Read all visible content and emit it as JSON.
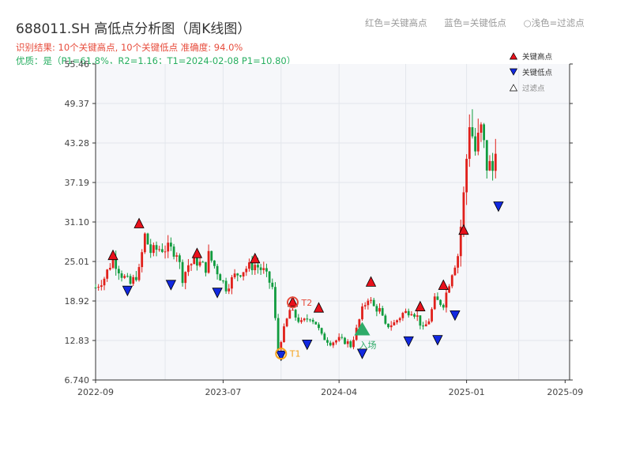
{
  "header": {
    "title": "688011.SH 高低点分析图（周K线图）",
    "result_text": "识别结果: 10个关键高点, 10个关键低点   准确度: 94.0%",
    "quality_text": "优质：是（P1=61.8%，R2=1.16；T1=2024-02-08 P1=10.80）",
    "legend_text": [
      "红色=关键高点",
      "蓝色=关键低点",
      "○浅色=过滤点"
    ]
  },
  "colors": {
    "up": "#e0201b",
    "down": "#119c3f",
    "high_marker": "#e8111b",
    "low_marker": "#1128e0",
    "t_marker": "#f5a21b",
    "t2_label": "#e74c3c",
    "entry": "#2eab68",
    "plot_bg": "#f6f7fa",
    "grid": "#e3e6ec"
  },
  "chart_data": {
    "type": "candlestick",
    "title": "688011.SH 高低点分析图（周K线图）",
    "y_ticks": [
      "55.46",
      "49.37",
      "43.28",
      "37.19",
      "31.10",
      "25.01",
      "18.92",
      "12.83",
      "6.740"
    ],
    "ylim": [
      6.74,
      55.46
    ],
    "x_ticks": [
      "2022-09",
      "2023-07",
      "2024-04",
      "2025-01",
      "2025-09"
    ],
    "x_tick_weeks": [
      0,
      44,
      84,
      128,
      162
    ],
    "x_range_weeks": [
      0,
      163
    ],
    "legend": {
      "position": "top-right",
      "items": [
        "关键高点",
        "关键低点",
        "过滤点"
      ]
    },
    "grid": true,
    "anchors": [
      [
        0,
        21.0
      ],
      [
        3,
        22.5
      ],
      [
        6,
        25.5
      ],
      [
        9,
        23.0
      ],
      [
        12,
        21.5
      ],
      [
        15,
        23.5
      ],
      [
        17,
        29.0
      ],
      [
        19,
        26.5
      ],
      [
        22,
        27.0
      ],
      [
        25,
        27.0
      ],
      [
        28,
        26.5
      ],
      [
        30,
        22.5
      ],
      [
        32,
        24.5
      ],
      [
        35,
        25.0
      ],
      [
        38,
        24.0
      ],
      [
        39,
        26.0
      ],
      [
        42,
        23.5
      ],
      [
        45,
        21.0
      ],
      [
        48,
        22.8
      ],
      [
        52,
        24.0
      ],
      [
        55,
        24.5
      ],
      [
        58,
        23.5
      ],
      [
        61,
        21.0
      ],
      [
        62,
        16.0
      ],
      [
        63,
        11.5
      ],
      [
        65,
        14.5
      ],
      [
        67,
        17.5
      ],
      [
        69,
        16.5
      ],
      [
        71,
        15.5
      ],
      [
        74,
        16.5
      ],
      [
        76,
        15.5
      ],
      [
        78,
        13.5
      ],
      [
        81,
        12.5
      ],
      [
        84,
        13.0
      ],
      [
        87,
        12.5
      ],
      [
        88,
        12.0
      ],
      [
        90,
        14.5
      ],
      [
        92,
        17.5
      ],
      [
        94,
        19.5
      ],
      [
        96,
        18.0
      ],
      [
        98,
        17.5
      ],
      [
        100,
        15.0
      ],
      [
        103,
        15.5
      ],
      [
        106,
        17.0
      ],
      [
        109,
        17.5
      ],
      [
        111,
        16.5
      ],
      [
        113,
        14.5
      ],
      [
        115,
        16.0
      ],
      [
        117,
        19.0
      ],
      [
        120,
        18.5
      ],
      [
        123,
        23.5
      ],
      [
        125,
        26.0
      ],
      [
        127,
        35.0
      ],
      [
        129,
        47.0
      ],
      [
        131,
        42.0
      ],
      [
        133,
        45.0
      ],
      [
        135,
        40.0
      ],
      [
        137,
        39.0
      ],
      [
        138,
        44.0
      ]
    ],
    "key_highs": [
      {
        "x": 6,
        "y": 25.9
      },
      {
        "x": 15,
        "y": 30.8
      },
      {
        "x": 35,
        "y": 26.2
      },
      {
        "x": 55,
        "y": 25.4
      },
      {
        "x": 68,
        "y": 18.7
      },
      {
        "x": 77,
        "y": 17.8
      },
      {
        "x": 95,
        "y": 21.8
      },
      {
        "x": 112,
        "y": 18.0
      },
      {
        "x": 120,
        "y": 21.3
      },
      {
        "x": 127,
        "y": 29.8
      }
    ],
    "key_lows": [
      {
        "x": 11,
        "y": 20.6
      },
      {
        "x": 26,
        "y": 21.5
      },
      {
        "x": 42,
        "y": 20.3
      },
      {
        "x": 64,
        "y": 10.6
      },
      {
        "x": 73,
        "y": 12.3
      },
      {
        "x": 92,
        "y": 10.9
      },
      {
        "x": 108,
        "y": 12.8
      },
      {
        "x": 118,
        "y": 13.0
      },
      {
        "x": 124,
        "y": 16.8
      },
      {
        "x": 139,
        "y": 33.6
      }
    ],
    "filtered_points": [],
    "annotations": [
      {
        "label": "T1",
        "x": 64,
        "y": 10.8,
        "kind": "t1"
      },
      {
        "label": "T2",
        "x": 68,
        "y": 18.7,
        "kind": "t2"
      },
      {
        "label": "入场",
        "x": 92,
        "y": 14.6,
        "kind": "entry"
      }
    ]
  }
}
